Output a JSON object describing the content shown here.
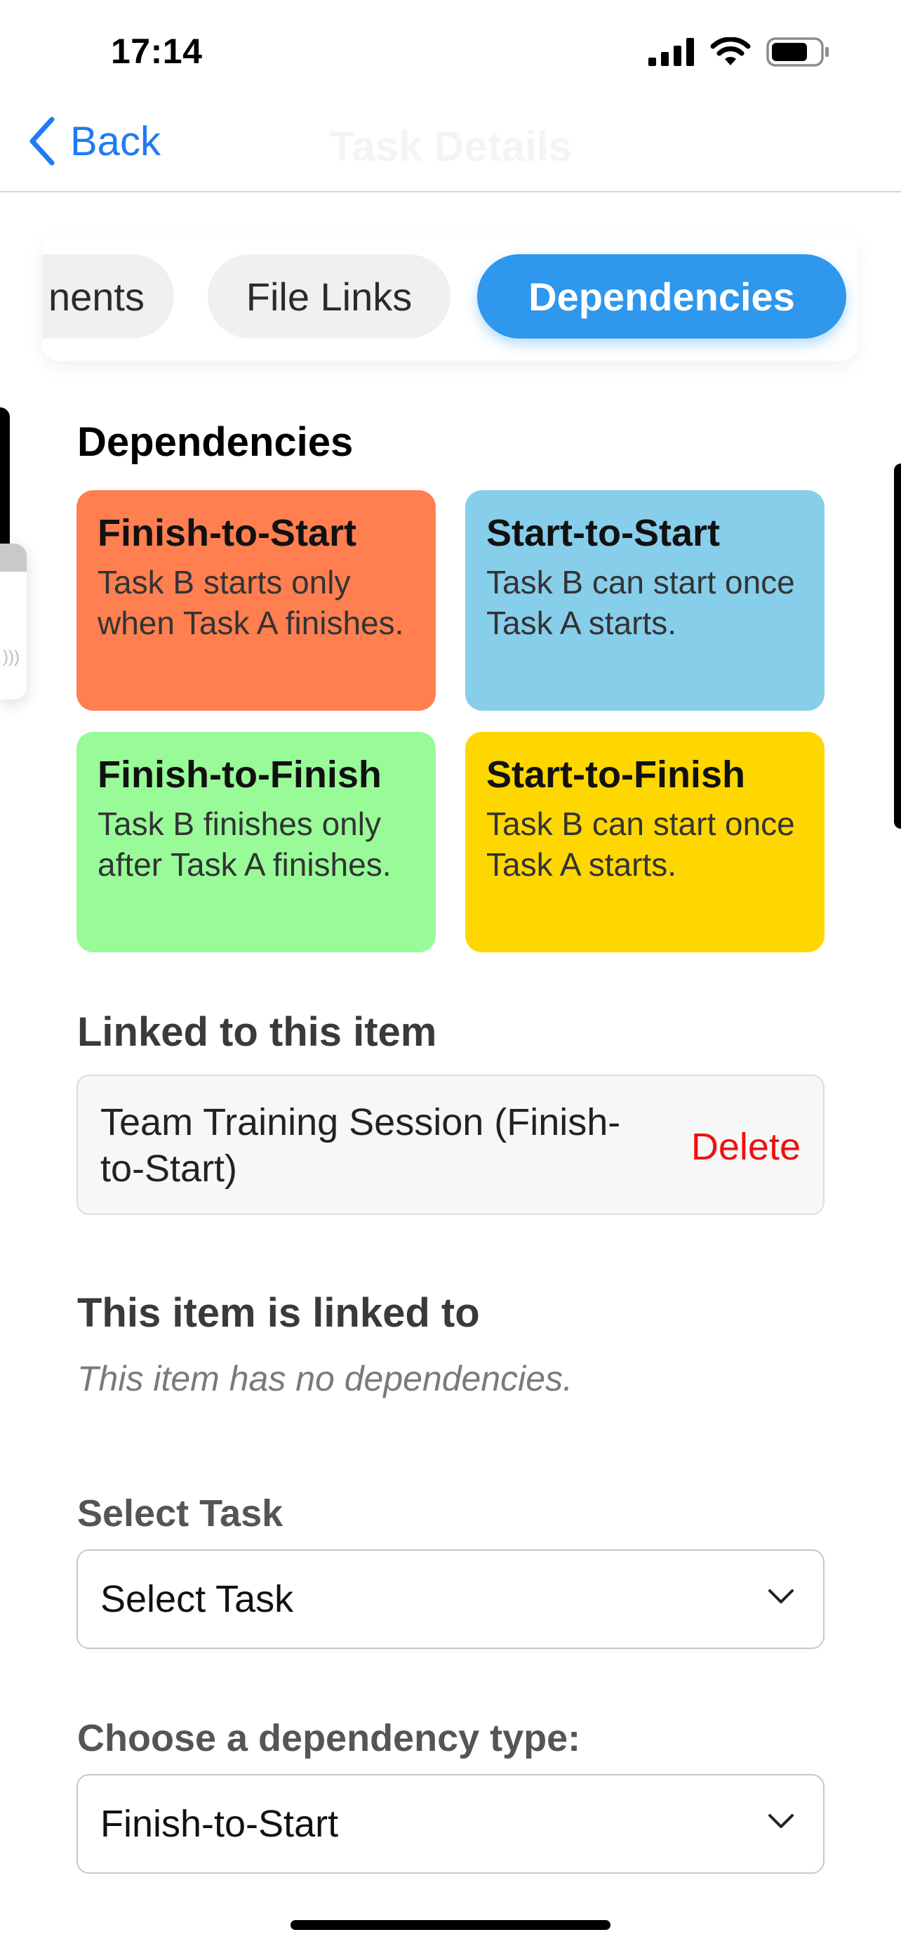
{
  "status_bar": {
    "time": "17:14"
  },
  "nav": {
    "back_label": "Back",
    "title": "Task Details"
  },
  "tabs": [
    {
      "label": "Comments",
      "visible_text": "nents"
    },
    {
      "label": "File Links"
    },
    {
      "label": "Dependencies",
      "active": true
    }
  ],
  "section_title": "Dependencies",
  "dependency_types": [
    {
      "title": "Finish-to-Start",
      "description": "Task B starts only when Task A finishes.",
      "color": "#ff7f50"
    },
    {
      "title": "Start-to-Start",
      "description": "Task B can start once Task A starts.",
      "color": "#87ceeb"
    },
    {
      "title": "Finish-to-Finish",
      "description": "Task B finishes only after Task A finishes.",
      "color": "#98fb98"
    },
    {
      "title": "Start-to-Finish",
      "description": "Task B can start once Task A starts.",
      "color": "#ffd700"
    }
  ],
  "linked_to_item": {
    "heading": "Linked to this item",
    "entries": [
      {
        "text": "Team Training Session (Finish-to-Start)",
        "delete_label": "Delete"
      }
    ]
  },
  "item_linked_to": {
    "heading": "This item is linked to",
    "empty_text": "This item has no dependencies."
  },
  "form": {
    "task_label": "Select Task",
    "task_value": "Select Task",
    "type_label": "Choose a dependency type:",
    "type_value": "Finish-to-Start"
  },
  "colors": {
    "accent": "#2f97ec",
    "back_link": "#1e7cf2",
    "delete": "#ee1111"
  },
  "icons": [
    "back-chevron-icon",
    "cellular-signal-icon",
    "wifi-icon",
    "battery-icon",
    "chevron-down-icon"
  ]
}
